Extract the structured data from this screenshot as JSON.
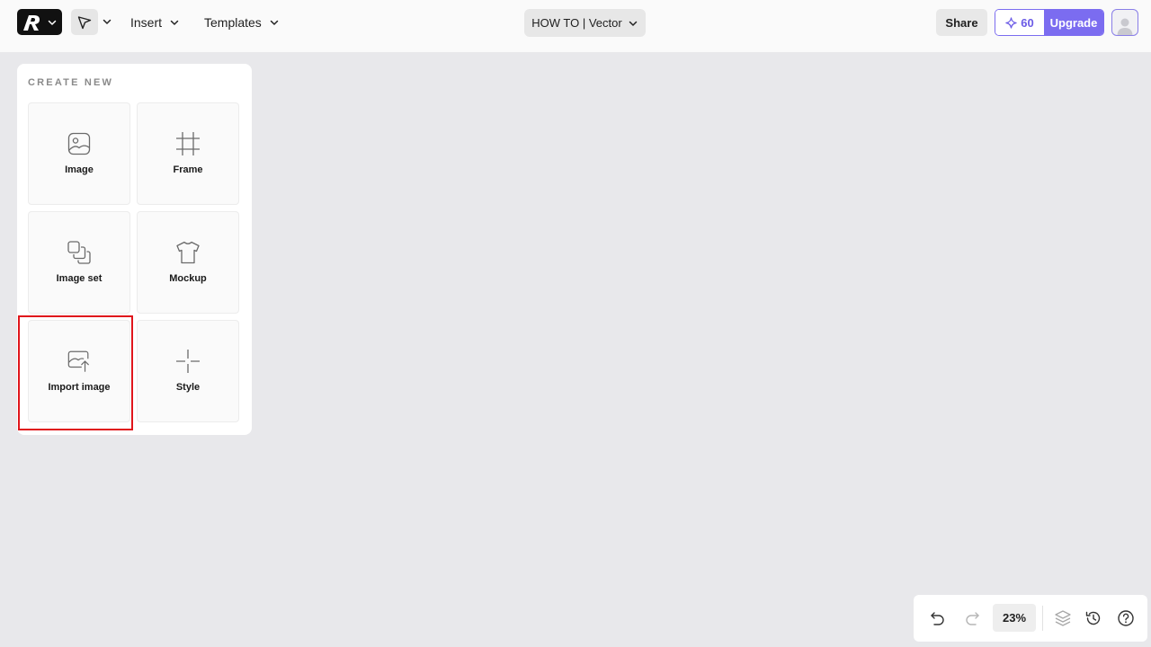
{
  "toolbar": {
    "insert_label": "Insert",
    "templates_label": "Templates",
    "document_title": "HOW TO | Vector",
    "share_label": "Share",
    "credits_count": "60",
    "upgrade_label": "Upgrade"
  },
  "create_panel": {
    "title": "CREATE NEW",
    "tiles": [
      {
        "label": "Image",
        "icon": "image-icon"
      },
      {
        "label": "Frame",
        "icon": "frame-icon"
      },
      {
        "label": "Image set",
        "icon": "image-set-icon"
      },
      {
        "label": "Mockup",
        "icon": "tshirt-icon"
      },
      {
        "label": "Import image",
        "icon": "import-image-icon"
      },
      {
        "label": "Style",
        "icon": "style-crosshair-icon"
      }
    ]
  },
  "bottom_bar": {
    "zoom_level": "23%"
  },
  "colors": {
    "accent": "#7b6cf0",
    "highlight": "#e0151b",
    "canvas": "#e8e8eb"
  }
}
